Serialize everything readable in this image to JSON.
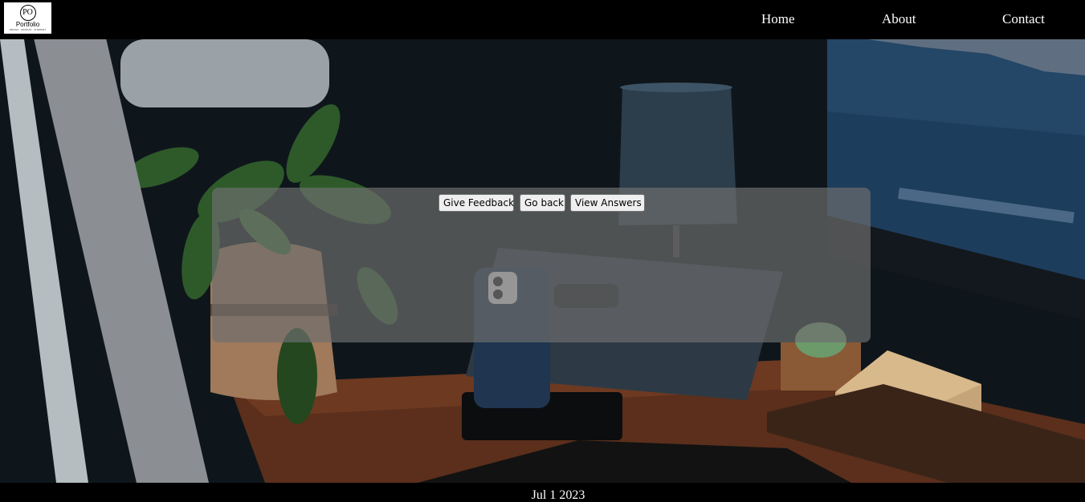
{
  "header": {
    "logo": {
      "monogram": "PO",
      "brand": "Portfolio",
      "tagline": "DESIGN · GRAPHIC · INTERNET"
    },
    "nav": [
      {
        "label": "Home"
      },
      {
        "label": "About"
      },
      {
        "label": "Contact"
      }
    ]
  },
  "main": {
    "buttons": {
      "give_feedback": "Give Feedback",
      "go_back": "Go back",
      "view_answers": "View Answers"
    }
  },
  "footer": {
    "text": "Jul 1 2023"
  },
  "colors": {
    "nav_bg": "#000000",
    "nav_text": "#ffffff",
    "panel_bg": "rgba(110,110,110,0.68)"
  }
}
